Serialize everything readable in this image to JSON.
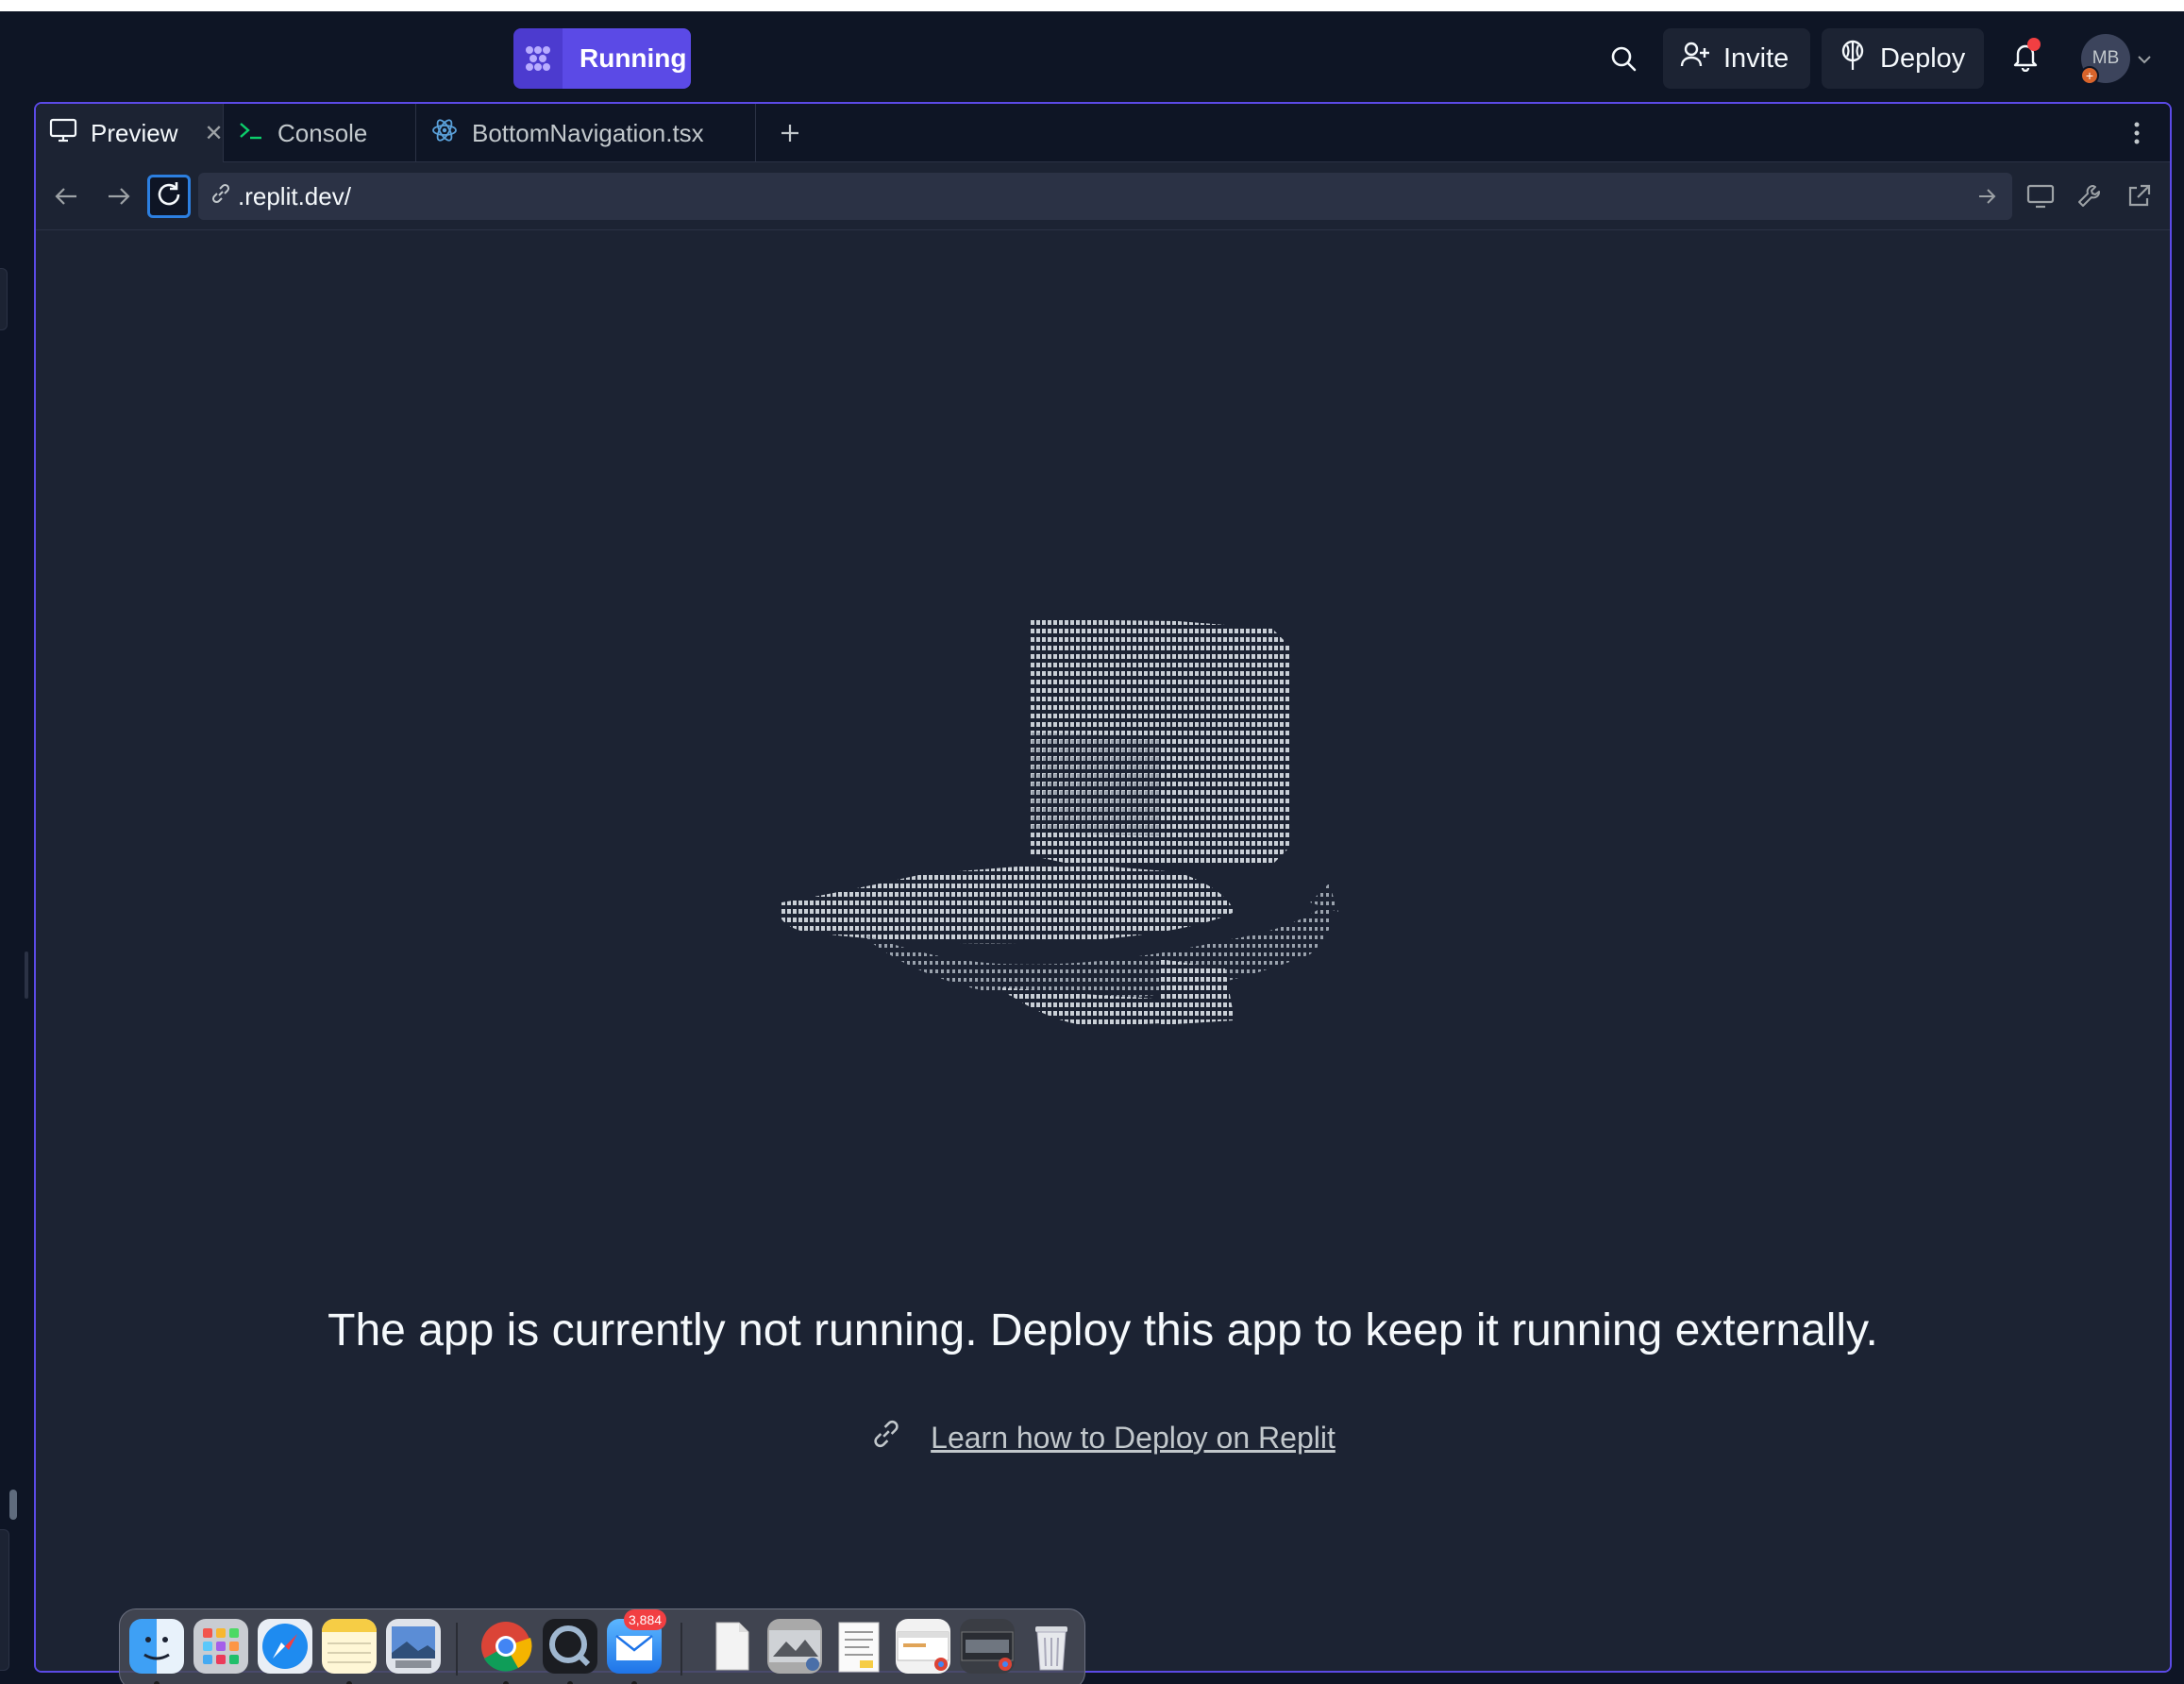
{
  "topbar": {
    "run_label": "Running",
    "invite_label": "Invite",
    "deploy_label": "Deploy",
    "avatar_initials": "MB"
  },
  "tabs": [
    {
      "label": "Preview",
      "icon": "monitor-icon"
    },
    {
      "label": "Console",
      "icon": "terminal-icon"
    },
    {
      "label": "BottomNavigation.tsx",
      "icon": "react-icon"
    }
  ],
  "url_bar": {
    "value": ".replit.dev/"
  },
  "content": {
    "message": "The app is currently not running. Deploy this app to keep it running externally.",
    "learn_link": "Learn how to Deploy on Replit"
  },
  "dock": {
    "mail_badge": "3,884",
    "apps": [
      "finder",
      "launchpad",
      "safari",
      "notes",
      "preview",
      "chrome",
      "quicktime",
      "mail",
      "document",
      "screenshot",
      "text-document",
      "chrome-window",
      "chrome-window-2",
      "trash"
    ]
  },
  "colors": {
    "accent": "#5b4ae6",
    "background": "#0e1525",
    "surface": "#1c2333",
    "focus": "#2c7fe0",
    "notification": "#f23f42"
  }
}
